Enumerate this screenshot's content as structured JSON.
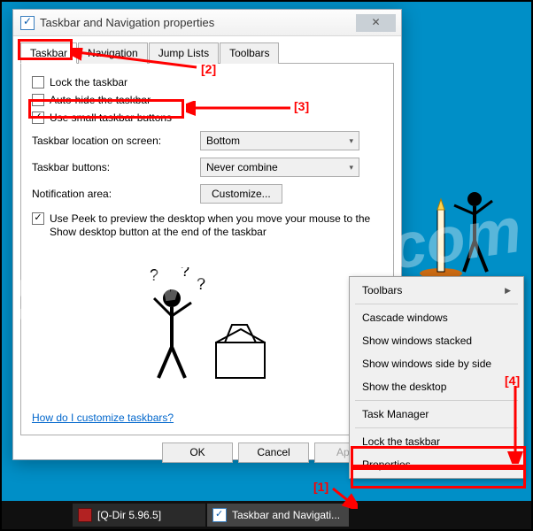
{
  "watermark": "SoftwareOK.com",
  "dialog": {
    "title": "Taskbar and Navigation properties",
    "tabs": [
      "Taskbar",
      "Navigation",
      "Jump Lists",
      "Toolbars"
    ],
    "checkboxes": {
      "lock": "Lock the taskbar",
      "autohide": "Auto-hide the taskbar",
      "small": "Use small taskbar buttons"
    },
    "location_label": "Taskbar location on screen:",
    "location_value": "Bottom",
    "buttons_label": "Taskbar buttons:",
    "buttons_value": "Never combine",
    "notif_label": "Notification area:",
    "notif_button": "Customize...",
    "peek": "Use Peek to preview the desktop when you move your mouse to the Show desktop button at the end of the taskbar",
    "help_link": "How do I customize taskbars?",
    "ok": "OK",
    "cancel": "Cancel",
    "apply": "Apply"
  },
  "context_menu": {
    "items": [
      "Toolbars",
      "Cascade windows",
      "Show windows stacked",
      "Show windows side by side",
      "Show the desktop",
      "Task Manager",
      "Lock the taskbar",
      "Properties"
    ]
  },
  "taskbar": {
    "item1": "[Q-Dir 5.96.5]",
    "item2": "Taskbar and Navigati..."
  },
  "annotations": {
    "n1": "[1]",
    "n2": "[2]",
    "n3": "[3]",
    "n4": "[4]"
  }
}
